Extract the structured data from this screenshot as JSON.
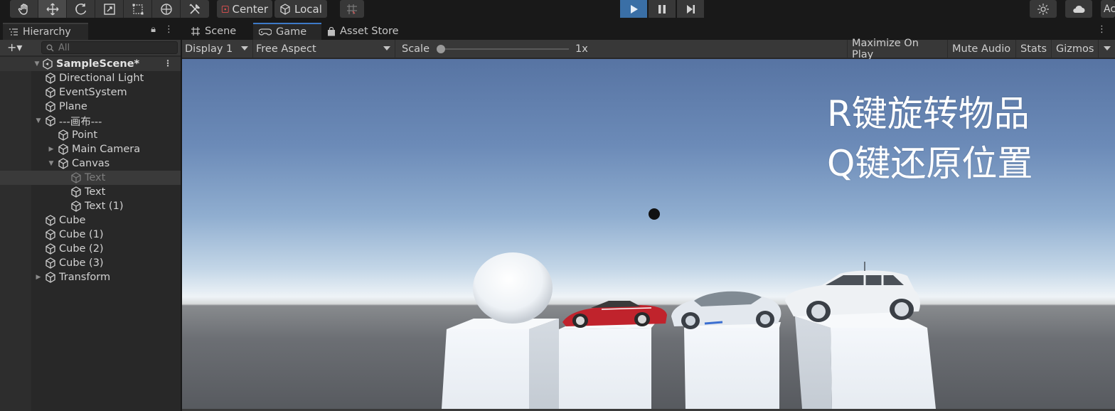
{
  "toolbar": {
    "tools": [
      {
        "name": "hand-tool",
        "icon": "hand-icon"
      },
      {
        "name": "move-tool",
        "icon": "move-arrows-icon"
      },
      {
        "name": "rotate-tool",
        "icon": "rotate-icon"
      },
      {
        "name": "scale-tool",
        "icon": "scale-icon"
      },
      {
        "name": "rect-tool",
        "icon": "rect-icon"
      },
      {
        "name": "transform-tool",
        "icon": "transform-icon"
      },
      {
        "name": "custom-tool",
        "icon": "tools-icon"
      }
    ],
    "pivot_mode": "Center",
    "pivot_rotation": "Local",
    "right_cut_label": "Ac"
  },
  "hierarchy": {
    "tab_label": "Hierarchy",
    "search_placeholder": "All",
    "scene_name": "SampleScene*",
    "items": [
      {
        "label": "Directional Light",
        "indent": 1,
        "arrow": "",
        "state": "normal"
      },
      {
        "label": "EventSystem",
        "indent": 1,
        "arrow": "",
        "state": "normal"
      },
      {
        "label": "Plane",
        "indent": 1,
        "arrow": "",
        "state": "normal"
      },
      {
        "label": "---画布---",
        "indent": 1,
        "arrow": "expanded",
        "state": "normal"
      },
      {
        "label": "Point",
        "indent": 2,
        "arrow": "",
        "state": "normal"
      },
      {
        "label": "Main Camera",
        "indent": 2,
        "arrow": "collapsed",
        "state": "normal"
      },
      {
        "label": "Canvas",
        "indent": 2,
        "arrow": "expanded",
        "state": "normal"
      },
      {
        "label": "Text",
        "indent": 3,
        "arrow": "",
        "state": "disabled"
      },
      {
        "label": "Text",
        "indent": 3,
        "arrow": "",
        "state": "normal"
      },
      {
        "label": "Text (1)",
        "indent": 3,
        "arrow": "",
        "state": "normal"
      },
      {
        "label": "Cube",
        "indent": 1,
        "arrow": "",
        "state": "normal"
      },
      {
        "label": "Cube (1)",
        "indent": 1,
        "arrow": "",
        "state": "normal"
      },
      {
        "label": "Cube (2)",
        "indent": 1,
        "arrow": "",
        "state": "normal"
      },
      {
        "label": "Cube (3)",
        "indent": 1,
        "arrow": "",
        "state": "normal"
      },
      {
        "label": "Transform",
        "indent": 1,
        "arrow": "collapsed",
        "state": "normal"
      }
    ]
  },
  "game_view": {
    "tabs": [
      {
        "label": "Scene",
        "icon": "grid-icon",
        "active": false
      },
      {
        "label": "Game",
        "icon": "gamepad-icon",
        "active": true
      },
      {
        "label": "Asset Store",
        "icon": "bag-icon",
        "active": false
      }
    ],
    "display": "Display 1",
    "aspect": "Free Aspect",
    "scale_label": "Scale",
    "scale_value": "1x",
    "buttons": [
      "Maximize On Play",
      "Mute Audio",
      "Stats",
      "Gizmos"
    ],
    "overlay_lines": [
      "R键旋转物品",
      "Q键还原位置"
    ],
    "colors": {
      "play_active": "#3a6fa6",
      "tab_accent": "#3d7ac8",
      "car_red": "#c0232c"
    }
  }
}
